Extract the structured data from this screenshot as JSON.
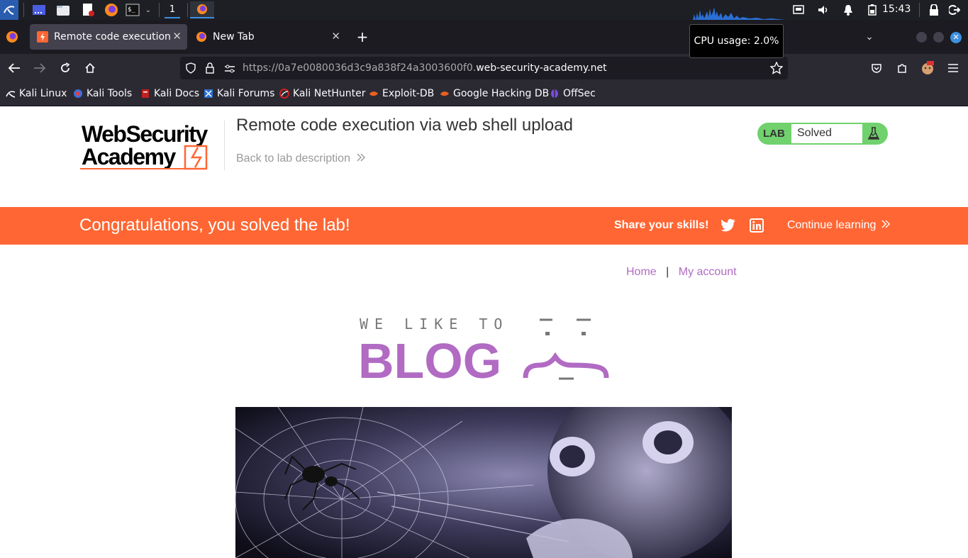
{
  "taskbar": {
    "workspace_number": "1",
    "clock": "15:43"
  },
  "browser": {
    "tabs": [
      {
        "label": "Remote code execution via web shell upload",
        "active": true
      },
      {
        "label": "New Tab",
        "active": false
      }
    ],
    "tooltip": "CPU usage: 2.0%",
    "url_prefix": "https://0a7e0080036d3c9a838f24a3003600f0.",
    "url_domain": "web-security-academy.net"
  },
  "bookmarks": [
    {
      "label": "Kali Linux",
      "icon": "kali-dragon-icon"
    },
    {
      "label": "Kali Tools",
      "icon": "kali-tools-icon"
    },
    {
      "label": "Kali Docs",
      "icon": "kali-docs-icon"
    },
    {
      "label": "Kali Forums",
      "icon": "kali-forums-icon"
    },
    {
      "label": "Kali NetHunter",
      "icon": "nethunter-icon"
    },
    {
      "label": "Exploit-DB",
      "icon": "exploit-db-icon"
    },
    {
      "label": "Google Hacking DB",
      "icon": "ghdb-icon"
    },
    {
      "label": "OffSec",
      "icon": "offsec-icon"
    }
  ],
  "page": {
    "logo_line1": "WebSecurity",
    "logo_line2": "Academy",
    "lab_title": "Remote code execution via web shell upload",
    "back_link": "Back to lab description",
    "lab_badge": "LAB",
    "lab_status": "Solved",
    "congrats": "Congratulations, you solved the lab!",
    "share": "Share your skills!",
    "continue": "Continue learning",
    "nav_home": "Home",
    "nav_sep": "|",
    "nav_account": "My account",
    "blog_tagline": "WE LIKE TO",
    "blog_word": "BLOG"
  },
  "colors": {
    "orange": "#ff6633",
    "lab_green": "#70d16d",
    "link_purple": "#b16bc3"
  }
}
